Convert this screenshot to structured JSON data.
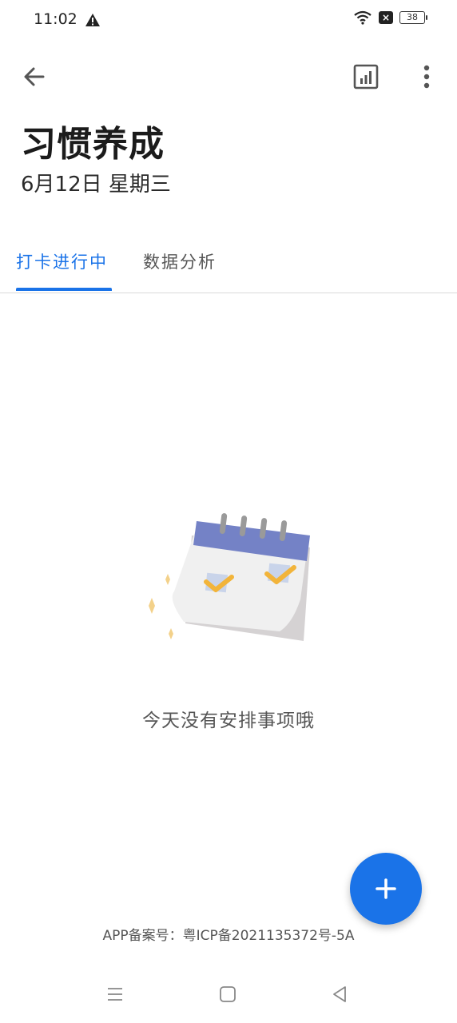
{
  "status_bar": {
    "time": "11:02",
    "battery": "38",
    "icons": [
      "warning-icon",
      "wifi-icon",
      "close-box-icon",
      "battery-icon"
    ]
  },
  "app_bar": {
    "title": "习惯养成",
    "date": "6月12日 星期三",
    "icons": [
      "back-arrow-icon",
      "stats-icon",
      "more-vert-icon"
    ]
  },
  "tabs": [
    {
      "label": "打卡进行中",
      "active": true
    },
    {
      "label": "数据分析",
      "active": false
    }
  ],
  "empty_state": {
    "message": "今天没有安排事项哦",
    "illustration": "calendar-checkmarks-illustration"
  },
  "fab": {
    "icon": "plus-icon"
  },
  "footer": {
    "icp": "APP备案号：粤ICP备2021135372号-5A"
  },
  "nav_bar": {
    "icons": [
      "menu-icon",
      "home-square-icon",
      "back-triangle-icon"
    ]
  },
  "colors": {
    "accent": "#1a73e8",
    "calendar_band": "#7482c6",
    "check": "#f2b43a",
    "sparkle": "#f3d18a"
  }
}
